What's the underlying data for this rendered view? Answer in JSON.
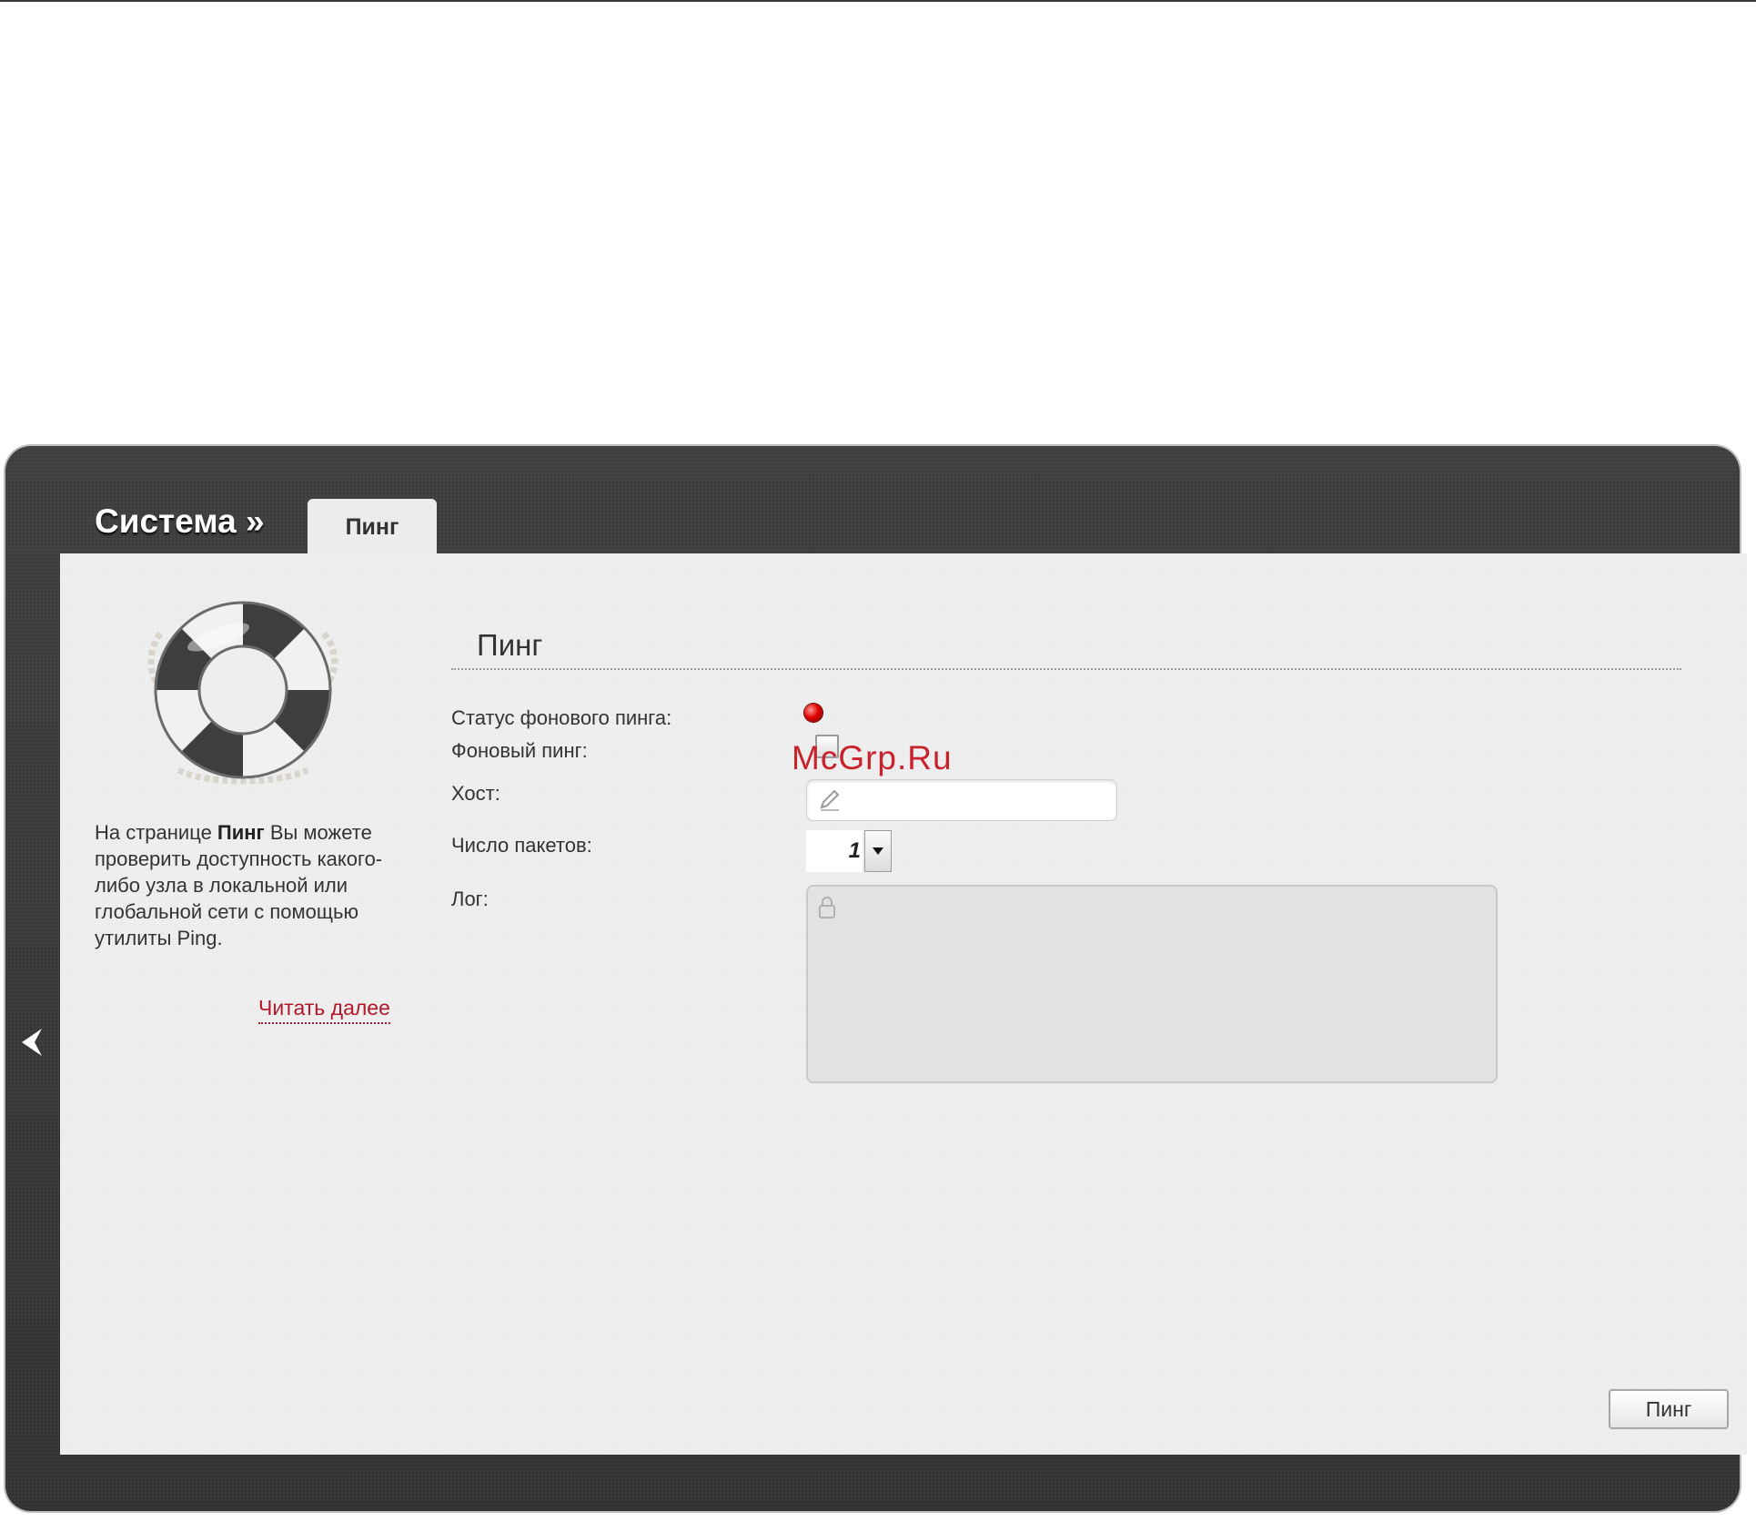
{
  "breadcrumb": {
    "section": "Система »",
    "active_tab": "Пинг"
  },
  "sidebar": {
    "help_prefix": "На странице ",
    "help_bold": "Пинг",
    "help_suffix": " Вы можете проверить доступность какого-либо узла в локальной или глобальной сети с помощью утилиты Ping.",
    "read_more": "Читать далее"
  },
  "form": {
    "title": "Пинг",
    "status_label": "Статус фонового пинга:",
    "status_color": "#e00000",
    "background_ping_label": "Фоновый пинг:",
    "background_ping_checked": false,
    "host_label": "Хост:",
    "host_value": "",
    "packets_label": "Число пакетов:",
    "packets_value": "1",
    "log_label": "Лог:",
    "log_value": ""
  },
  "watermark": "McGrp.Ru",
  "actions": {
    "ping_button": "Пинг"
  },
  "icons": {
    "lifebuoy": "lifebuoy-icon",
    "back": "chevron-left-icon",
    "pencil": "pencil-icon",
    "lock": "lock-icon",
    "dropdown": "caret-down-icon"
  }
}
